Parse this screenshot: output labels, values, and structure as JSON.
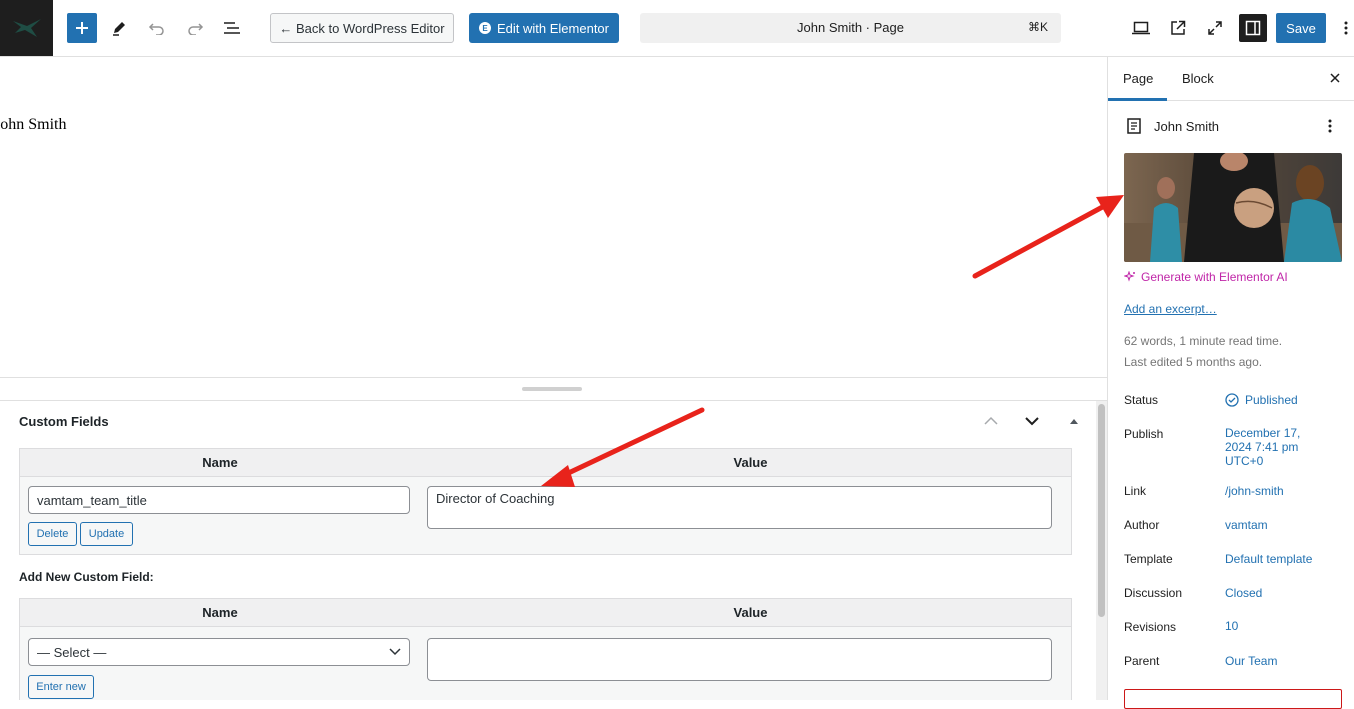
{
  "toolbar": {
    "back_label": "← Back to WordPress Editor",
    "elementor_label": "Edit with Elementor",
    "command_title": "John Smith · Page",
    "command_shortcut": "⌘K",
    "save_label": "Save"
  },
  "canvas": {
    "page_title": "John Smith"
  },
  "custom_fields": {
    "title": "Custom Fields",
    "col_name": "Name",
    "col_value": "Value",
    "existing": {
      "name": "vamtam_team_title",
      "value": "Director of Coaching",
      "delete_label": "Delete",
      "update_label": "Update"
    },
    "add_new_label": "Add New Custom Field:",
    "new": {
      "select_value": "— Select —",
      "enter_new_label": "Enter new"
    }
  },
  "sidebar": {
    "tab_page": "Page",
    "tab_block": "Block",
    "doc_title": "John Smith",
    "ai_link": "Generate with Elementor AI",
    "excerpt_link": "Add an excerpt…",
    "word_count": "62 words, 1 minute read time.",
    "last_edited": "Last edited 5 months ago.",
    "rows": [
      {
        "label": "Status",
        "value": "Published"
      },
      {
        "label": "Publish",
        "value": "December 17, 2024 7:41 pm UTC+0"
      },
      {
        "label": "Link",
        "value": "/john-smith"
      },
      {
        "label": "Author",
        "value": "vamtam"
      },
      {
        "label": "Template",
        "value": "Default template"
      },
      {
        "label": "Discussion",
        "value": "Closed"
      },
      {
        "label": "Revisions",
        "value": "10"
      },
      {
        "label": "Parent",
        "value": "Our Team"
      }
    ]
  },
  "colors": {
    "accent": "#2271b1",
    "ai": "#c026a8",
    "annotation_arrow": "#e8231b"
  }
}
